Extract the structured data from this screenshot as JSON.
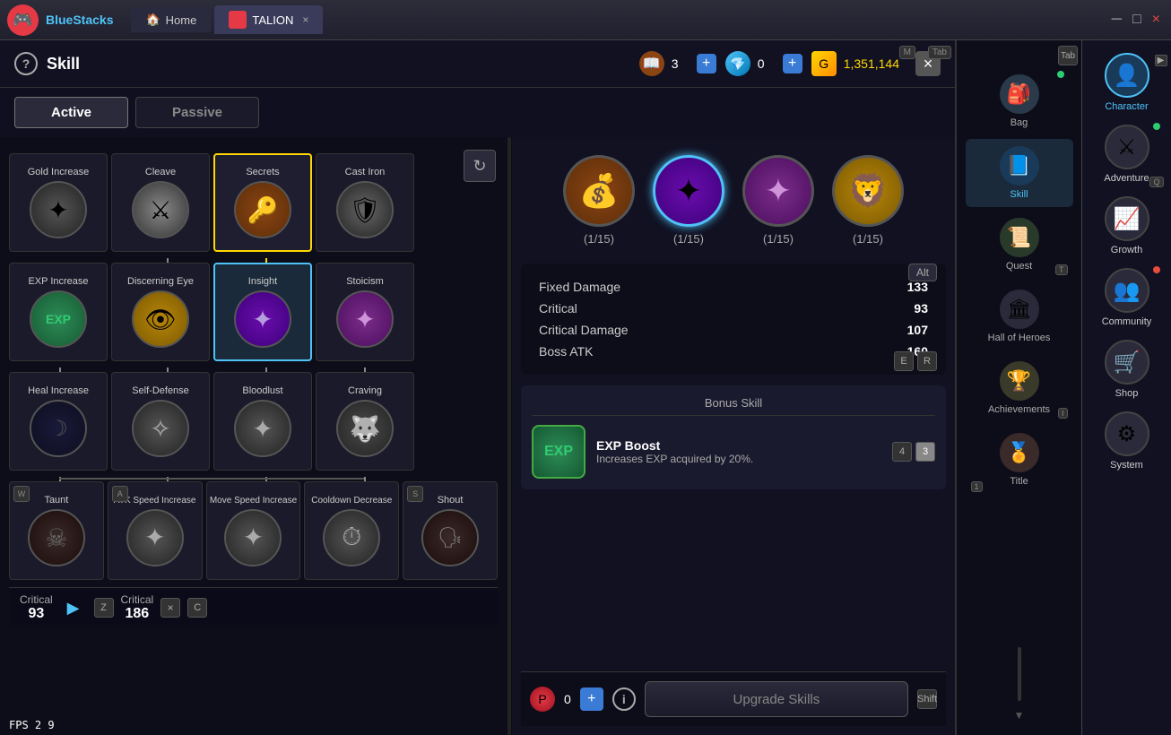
{
  "titlebar": {
    "logo": "🎮",
    "app_name": "BlueStacks",
    "home_tab": "Home",
    "game_tab": "TALION",
    "close_label": "×",
    "min_label": "─",
    "max_label": "□",
    "restore_label": "❐"
  },
  "header": {
    "help_label": "?",
    "title": "Skill",
    "book_icon": "📖",
    "book_count": "3",
    "plus_label": "+",
    "gem_icon": "💎",
    "gem_count": "0",
    "gold_icon": "G",
    "gold_count": "1,351,144",
    "close_icon": "×",
    "tab_key": "Tab",
    "m_key": "M"
  },
  "tabs": {
    "active_label": "Active",
    "passive_label": "Passive",
    "selected": "active"
  },
  "skill_grid": {
    "rows": [
      [
        {
          "name": "Gold Increase",
          "icon_class": "icon-gold-increase",
          "icon": "✦",
          "selected": false
        },
        {
          "name": "Cleave",
          "icon_class": "icon-cleave",
          "icon": "⚔",
          "selected": false
        },
        {
          "name": "Secrets",
          "icon_class": "icon-secrets",
          "icon": "🔑",
          "selected": true
        },
        {
          "name": "Cast Iron",
          "icon_class": "icon-cast-iron",
          "icon": "🛡",
          "selected": false
        }
      ],
      [
        {
          "name": "EXP Increase",
          "icon_class": "icon-exp-increase",
          "icon": "EXP",
          "selected": false
        },
        {
          "name": "Discerning Eye",
          "icon_class": "icon-discerning-eye",
          "icon": "👁",
          "selected": false
        },
        {
          "name": "Insight",
          "icon_class": "icon-insight",
          "icon": "✦",
          "selected": true
        },
        {
          "name": "Stoicism",
          "icon_class": "icon-stoicism",
          "icon": "✦",
          "selected": false
        }
      ],
      [
        {
          "name": "Heal Increase",
          "icon_class": "icon-heal-increase",
          "icon": "☽",
          "selected": false
        },
        {
          "name": "Self-Defense",
          "icon_class": "icon-self-defense",
          "icon": "✧",
          "selected": false
        },
        {
          "name": "Bloodlust",
          "icon_class": "icon-bloodlust",
          "icon": "✦",
          "selected": false
        },
        {
          "name": "Craving",
          "icon_class": "icon-craving",
          "icon": "🐺",
          "selected": false
        }
      ],
      [
        {
          "name": "Taunt",
          "icon_class": "icon-taunt",
          "icon": "☠",
          "selected": false
        },
        {
          "name": "ATK Speed Increase",
          "icon_class": "icon-atk-speed",
          "icon": "✦",
          "selected": false
        },
        {
          "name": "Move Speed Increase",
          "icon_class": "icon-move-speed",
          "icon": "✦",
          "selected": false
        },
        {
          "name": "Cooldown Decrease",
          "icon_class": "icon-cooldown",
          "icon": "⏱",
          "selected": false
        }
      ]
    ],
    "shout": {
      "name": "Shout",
      "icon_class": "icon-shout",
      "icon": "🗣"
    }
  },
  "bottom_stats": {
    "label1": "Critical",
    "val1": "93",
    "label2": "Critical",
    "val2": "186",
    "arrow": "▶",
    "key_z": "Z",
    "key_x": "×",
    "key_c": "C"
  },
  "skill_detail": {
    "icons": [
      {
        "icon": "💰",
        "level": "(1/15)",
        "bg": "radial-gradient(circle, #8b4513, #5c2d09)",
        "active": false
      },
      {
        "icon": "✦",
        "level": "(1/15)",
        "bg": "radial-gradient(circle, #6a0dad, #3d007a)",
        "active": true
      },
      {
        "icon": "✦",
        "level": "(1/15)",
        "bg": "radial-gradient(circle, #7b2d8b, #4a0d5c)",
        "active": false
      },
      {
        "icon": "🦁",
        "level": "(1/15)",
        "bg": "radial-gradient(circle, #b8860b, #7a5900)",
        "active": false
      }
    ],
    "alt_key": "Alt",
    "stats": [
      {
        "name": "Fixed Damage",
        "value": "133"
      },
      {
        "name": "Critical",
        "value": "93"
      },
      {
        "name": "Critical Damage",
        "value": "107"
      },
      {
        "name": "Boss ATK",
        "value": "160"
      }
    ],
    "bonus_title": "Bonus Skill",
    "bonus_icon": "EXP",
    "bonus_name": "EXP Boost",
    "bonus_desc": "Increases EXP acquired by 20%.",
    "bonus_number": "3",
    "upgrade_count": "0",
    "upgrade_plus": "+",
    "upgrade_info": "i",
    "upgrade_btn": "Upgrade Skills",
    "level_key": "4",
    "shift_key": "Shift"
  },
  "quick_sidebar": {
    "items": [
      {
        "id": "bag",
        "label": "Bag",
        "icon": "🎒",
        "dot": "green",
        "active": false
      },
      {
        "id": "skill",
        "label": "Skill",
        "icon": "📘",
        "dot": null,
        "active": true
      },
      {
        "id": "quest",
        "label": "Quest",
        "icon": "📜",
        "dot": null,
        "active": false
      },
      {
        "id": "hall",
        "label": "Hall of Heroes",
        "icon": "🏛",
        "dot": null,
        "active": false
      },
      {
        "id": "achievements",
        "label": "Achievements",
        "icon": "🏆",
        "dot": null,
        "active": false
      },
      {
        "id": "title",
        "label": "Title",
        "icon": "🏅",
        "dot": null,
        "active": false
      }
    ],
    "tab_key": "Tab",
    "t_key": "T",
    "i_key": "I"
  },
  "character_panel": {
    "items": [
      {
        "id": "character",
        "label": "Character",
        "icon": "👤",
        "dot": null,
        "selected": true
      },
      {
        "id": "adventure",
        "label": "Adventure",
        "icon": "⚔",
        "dot": "green",
        "selected": false
      },
      {
        "id": "growth",
        "label": "Growth",
        "icon": "📈",
        "dot": null,
        "selected": false
      },
      {
        "id": "community",
        "label": "Community",
        "icon": "👥",
        "dot": "red",
        "selected": false
      },
      {
        "id": "shop",
        "label": "Shop",
        "icon": "🛒",
        "dot": null,
        "selected": false
      },
      {
        "id": "system",
        "label": "System",
        "icon": "⚙",
        "dot": null,
        "selected": false
      }
    ],
    "key_q": "Q",
    "key_e": "E",
    "key_r": "R",
    "key_1": "1"
  },
  "fps": "FPS  2 9"
}
